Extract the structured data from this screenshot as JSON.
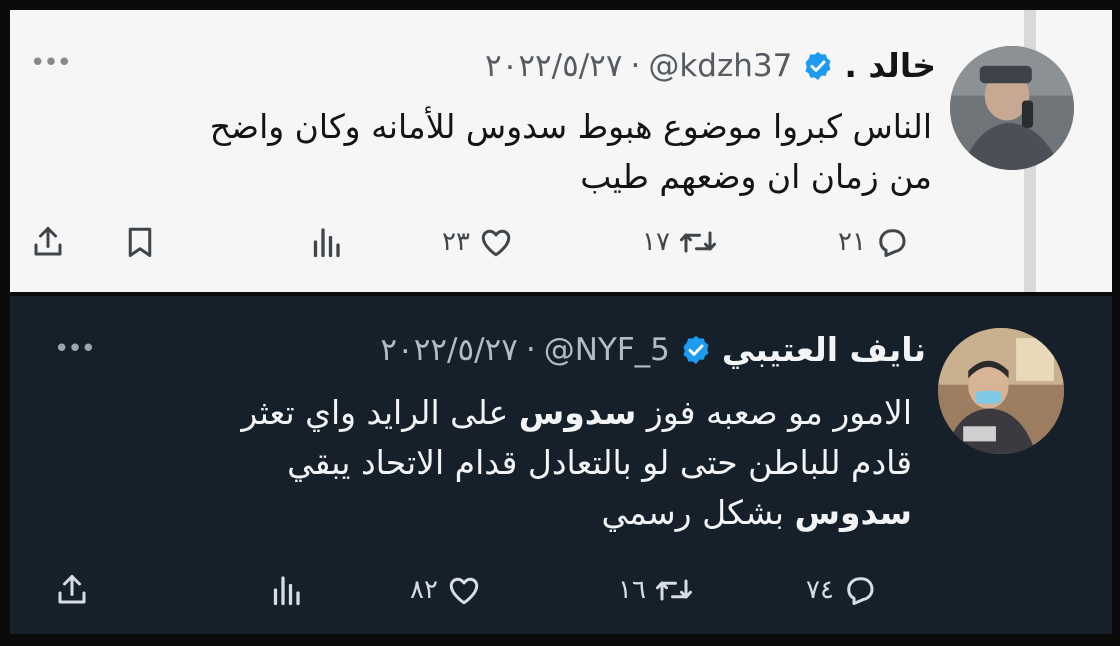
{
  "tweets": [
    {
      "name": "خالد .",
      "handle": "@kdzh37",
      "separator": "·",
      "date": "٢٠٢٢/٥/٢٧",
      "more_label": "•••",
      "text_lines": [
        [
          {
            "t": "الناس كبروا موضوع هبوط سدوس للأمانه وكان واضح"
          }
        ],
        [
          {
            "t": "من زمان ان وضعهم طيب"
          }
        ]
      ],
      "actions": {
        "reply": "٢١",
        "retweet": "١٧",
        "like": "٢٣"
      }
    },
    {
      "name": "نايف العتيبي",
      "handle": "@NYF_5",
      "separator": "·",
      "date": "٢٠٢٢/٥/٢٧",
      "more_label": "•••",
      "text_lines": [
        [
          {
            "t": "الامور مو صعبه فوز "
          },
          {
            "t": "سدوس",
            "b": true
          },
          {
            "t": " على الرايد واي تعثر"
          }
        ],
        [
          {
            "t": "قادم للباطن حتى لو بالتعادل قدام الاتحاد يبقي"
          }
        ],
        [
          {
            "t": "سدوس",
            "b": true
          },
          {
            "t": " بشكل رسمي"
          }
        ]
      ],
      "actions": {
        "reply": "٧٤",
        "retweet": "١٦",
        "like": "٨٢"
      }
    }
  ],
  "colors": {
    "light_bg": "#f6f6f6",
    "dark_bg": "#15202b",
    "verified_blue": "#1d9bf0"
  },
  "icons": [
    "verified-badge-icon",
    "more-icon",
    "reply-icon",
    "retweet-icon",
    "like-icon",
    "analytics-icon",
    "bookmark-icon",
    "share-icon"
  ]
}
